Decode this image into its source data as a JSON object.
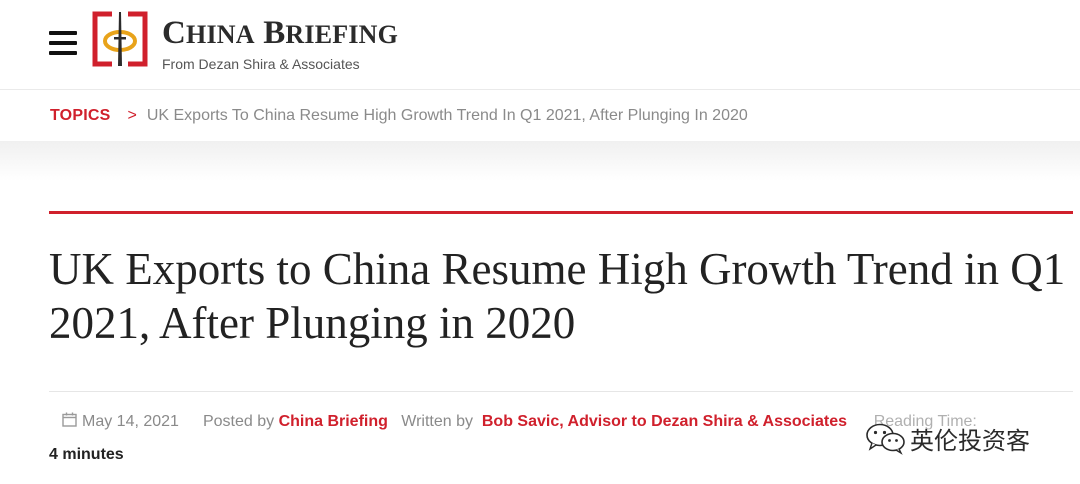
{
  "header": {
    "menu_icon": "hamburger-menu-icon",
    "logo": {
      "title_c": "C",
      "title_hina": "HINA",
      "title_b": " B",
      "title_riefing": "RIEFING",
      "subtitle": "From Dezan Shira & Associates",
      "colors": {
        "red": "#d0202c",
        "gold": "#e8a31a"
      }
    }
  },
  "breadcrumb": {
    "topics": "TOPICS",
    "separator": ">",
    "current": "UK Exports To China Resume High Growth Trend In Q1 2021, After Plunging In 2020"
  },
  "article": {
    "title": "UK Exports to China Resume High Growth Trend in Q1 2021, After Plunging in 2020",
    "meta": {
      "date_icon": "calendar-icon",
      "date": "May 14, 2021",
      "posted_by_label": "Posted by",
      "posted_by": "China Briefing",
      "written_by_label": "Written by",
      "author": "Bob Savic, Advisor to Dezan Shira & Associates",
      "reading_time_label": "Reading Time:",
      "reading_time": "4 minutes"
    }
  },
  "watermark": {
    "icon": "wechat-icon",
    "text": "英伦投资客"
  },
  "colors": {
    "accent": "#d0202c",
    "muted_text": "#8a8a8a",
    "title_text": "#222222"
  }
}
